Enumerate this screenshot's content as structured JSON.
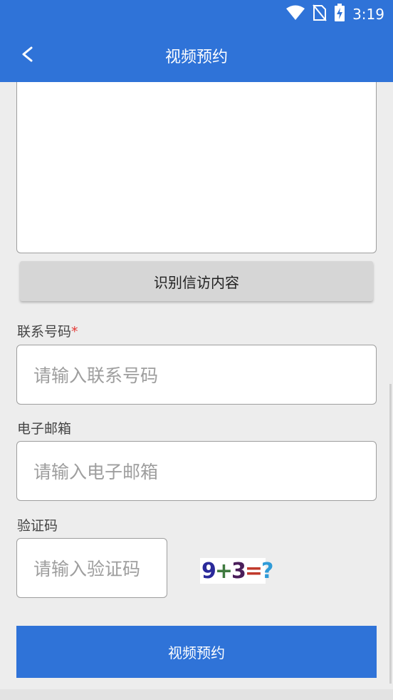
{
  "status_bar": {
    "time": "3:19",
    "icons": [
      "wifi-icon",
      "no-sim-icon",
      "battery-charging-icon"
    ]
  },
  "app_bar": {
    "back_icon": "chevron-left-icon",
    "title": "视频预约"
  },
  "form": {
    "recognize_button": "识别信访内容",
    "phone": {
      "label": "联系号码",
      "required_mark": "*",
      "placeholder": "请输入联系号码"
    },
    "email": {
      "label": "电子邮箱",
      "placeholder": "请输入电子邮箱"
    },
    "captcha": {
      "label": "验证码",
      "placeholder": "请输入验证码",
      "image_text": [
        "9",
        "+",
        "3",
        "=",
        "?"
      ],
      "image_colors": [
        "#2a2a9a",
        "#3f7a3f",
        "#4a1e5a",
        "#c0392b",
        "#2f9bd8"
      ]
    },
    "submit_button": "视频预约"
  },
  "colors": {
    "primary": "#2f73d8",
    "background": "#ededed",
    "required": "#e53935"
  }
}
